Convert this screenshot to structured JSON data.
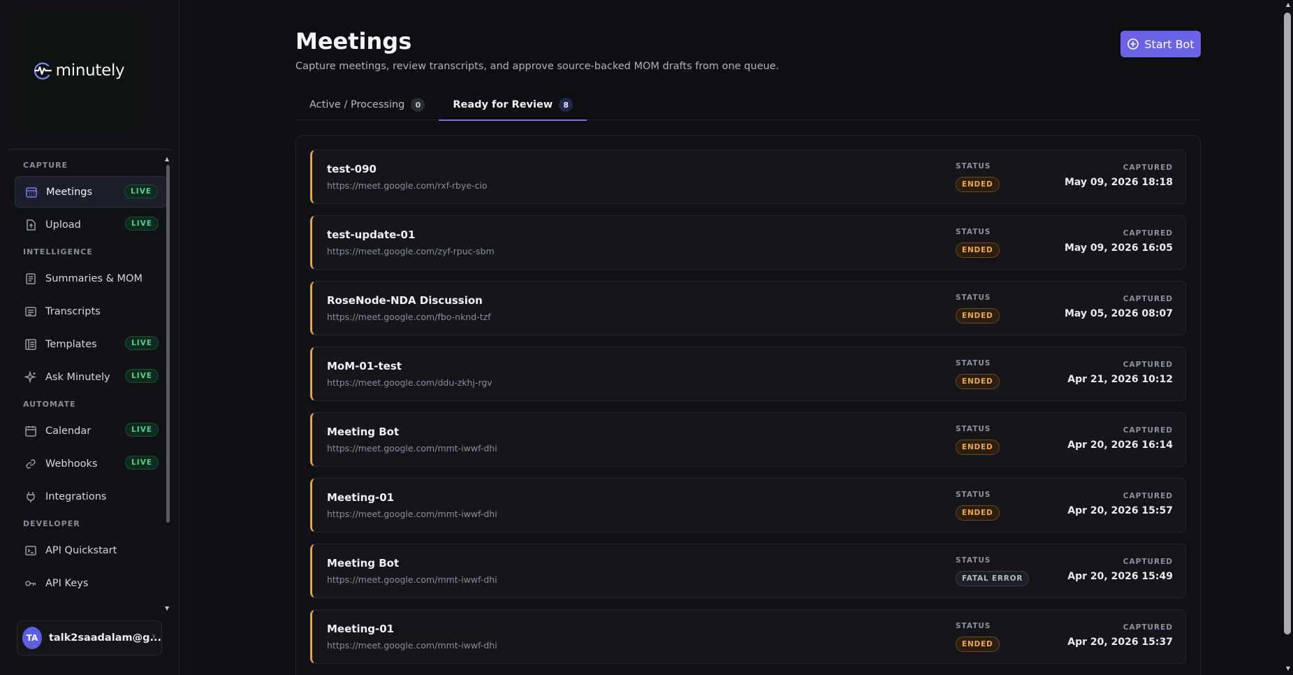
{
  "brand": {
    "name": "minutely"
  },
  "sidebar": {
    "sections": [
      {
        "label": "CAPTURE",
        "items": [
          {
            "label": "Meetings",
            "icon": "calendar-grid-icon",
            "badge": "LIVE",
            "active": true
          },
          {
            "label": "Upload",
            "icon": "upload-file-icon",
            "badge": "LIVE"
          }
        ]
      },
      {
        "label": "INTELLIGENCE",
        "items": [
          {
            "label": "Summaries & MOM",
            "icon": "summary-doc-icon"
          },
          {
            "label": "Transcripts",
            "icon": "transcript-icon"
          },
          {
            "label": "Templates",
            "icon": "template-icon",
            "badge": "LIVE"
          },
          {
            "label": "Ask Minutely",
            "icon": "sparkle-icon",
            "badge": "LIVE"
          }
        ]
      },
      {
        "label": "AUTOMATE",
        "items": [
          {
            "label": "Calendar",
            "icon": "calendar-icon",
            "badge": "LIVE"
          },
          {
            "label": "Webhooks",
            "icon": "link-icon",
            "badge": "LIVE"
          },
          {
            "label": "Integrations",
            "icon": "plug-icon"
          }
        ]
      },
      {
        "label": "DEVELOPER",
        "items": [
          {
            "label": "API Quickstart",
            "icon": "terminal-icon"
          },
          {
            "label": "API Keys",
            "icon": "key-icon"
          }
        ]
      }
    ]
  },
  "user": {
    "initials": "TA",
    "email": "talk2saadalam@g..."
  },
  "header": {
    "title": "Meetings",
    "subtitle": "Capture meetings, review transcripts, and approve source-backed MOM drafts from one queue.",
    "start_button": "Start Bot"
  },
  "tabs": [
    {
      "label": "Active / Processing",
      "count": "0",
      "active": false
    },
    {
      "label": "Ready for Review",
      "count": "8",
      "active": true
    }
  ],
  "labels": {
    "status": "STATUS",
    "captured": "CAPTURED"
  },
  "meetings": [
    {
      "title": "test-090",
      "url": "https://meet.google.com/rxf-rbye-cio",
      "status": "ENDED",
      "captured": "May 09, 2026 18:18"
    },
    {
      "title": "test-update-01",
      "url": "https://meet.google.com/zyf-rpuc-sbm",
      "status": "ENDED",
      "captured": "May 09, 2026 16:05"
    },
    {
      "title": "RoseNode-NDA Discussion",
      "url": "https://meet.google.com/fbo-nknd-tzf",
      "status": "ENDED",
      "captured": "May 05, 2026 08:07"
    },
    {
      "title": "MoM-01-test",
      "url": "https://meet.google.com/ddu-zkhj-rgv",
      "status": "ENDED",
      "captured": "Apr 21, 2026 10:12"
    },
    {
      "title": "Meeting Bot",
      "url": "https://meet.google.com/mmt-iwwf-dhi",
      "status": "ENDED",
      "captured": "Apr 20, 2026 16:14"
    },
    {
      "title": "Meeting-01",
      "url": "https://meet.google.com/mmt-iwwf-dhi",
      "status": "ENDED",
      "captured": "Apr 20, 2026 15:57"
    },
    {
      "title": "Meeting Bot",
      "url": "https://meet.google.com/mmt-iwwf-dhi",
      "status": "FATAL ERROR",
      "captured": "Apr 20, 2026 15:49"
    },
    {
      "title": "Meeting-01",
      "url": "https://meet.google.com/mmt-iwwf-dhi",
      "status": "ENDED",
      "captured": "Apr 20, 2026 15:37"
    }
  ],
  "colors": {
    "accent": "#6c63e8",
    "live": "#4fd18b",
    "ended": "#f0a94a",
    "card_border_left": "#e5a43f"
  }
}
